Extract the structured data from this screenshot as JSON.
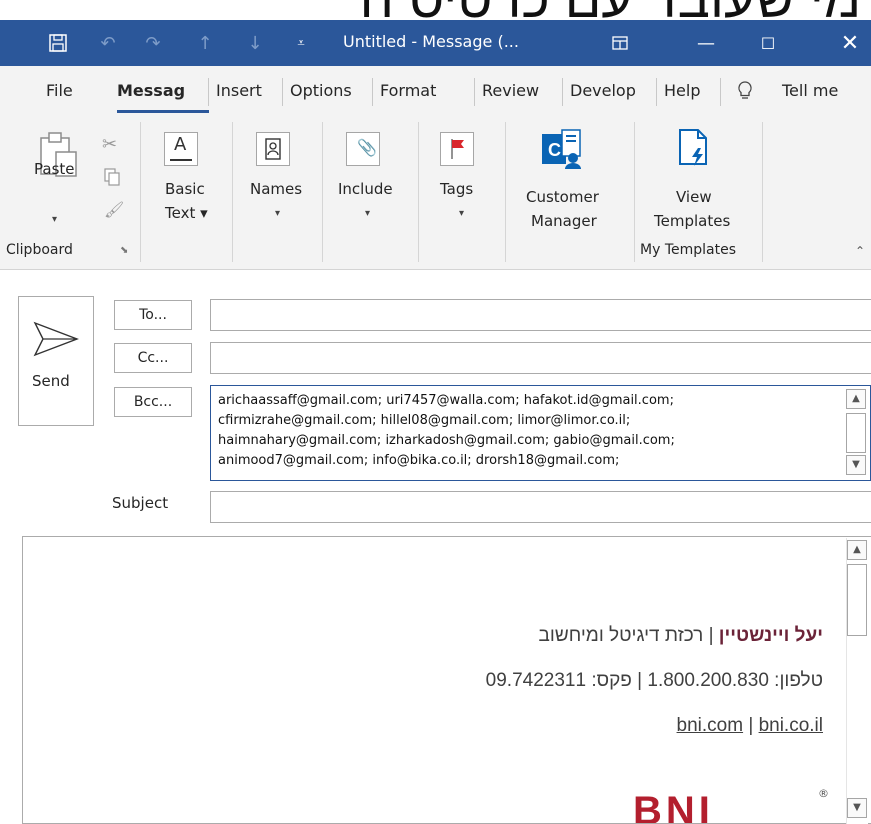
{
  "banner": {
    "text": "מי שעובד עם כרטיס ה"
  },
  "titlebar": {
    "title": "Untitled  -  Message (..."
  },
  "menubar": {
    "tabs": [
      "File",
      "Messag",
      "Insert",
      "Options",
      "Format ",
      "Review",
      "Develop",
      "Help",
      "Tell me"
    ]
  },
  "ribbon": {
    "paste": "Paste",
    "basic_text_1": "Basic",
    "basic_text_2": "Text",
    "names": "Names",
    "include": "Include",
    "tags": "Tags",
    "customer_1": "Customer",
    "customer_2": "Manager",
    "view_1": "View",
    "view_2": "Templates",
    "group_clipboard": "Clipboard",
    "group_my_templates": "My Templates"
  },
  "compose": {
    "send": "Send",
    "to": "To...",
    "cc": "Cc...",
    "bcc": "Bcc...",
    "subject": "Subject",
    "bcc_lines": [
      "arichaassaff@gmail.com; uri7457@walla.com; hafakot.id@gmail.com;",
      "cfirmizrahe@gmail.com; hillel08@gmail.com; limor@limor.co.il;",
      "haimnahary@gmail.com; izharkadosh@gmail.com; gabio@gmail.com;",
      "animood7@gmail.com; info@bika.co.il; drorsh18@gmail.com;"
    ]
  },
  "signature": {
    "name": "יעל ויינשטיין",
    "role": " | רכזת דיגיטל ומיחשוב",
    "phone_line": "טלפון: 1.800.200.830  | פקס: 09.7422311",
    "site1": "bni.com",
    "sep": " | ",
    "site2": "bni.co.il",
    "logo": "BNI"
  },
  "colors": {
    "titlebar": "#2b579a",
    "exchange_blue": "#0a64b4",
    "tag_red": "#d9262b"
  }
}
